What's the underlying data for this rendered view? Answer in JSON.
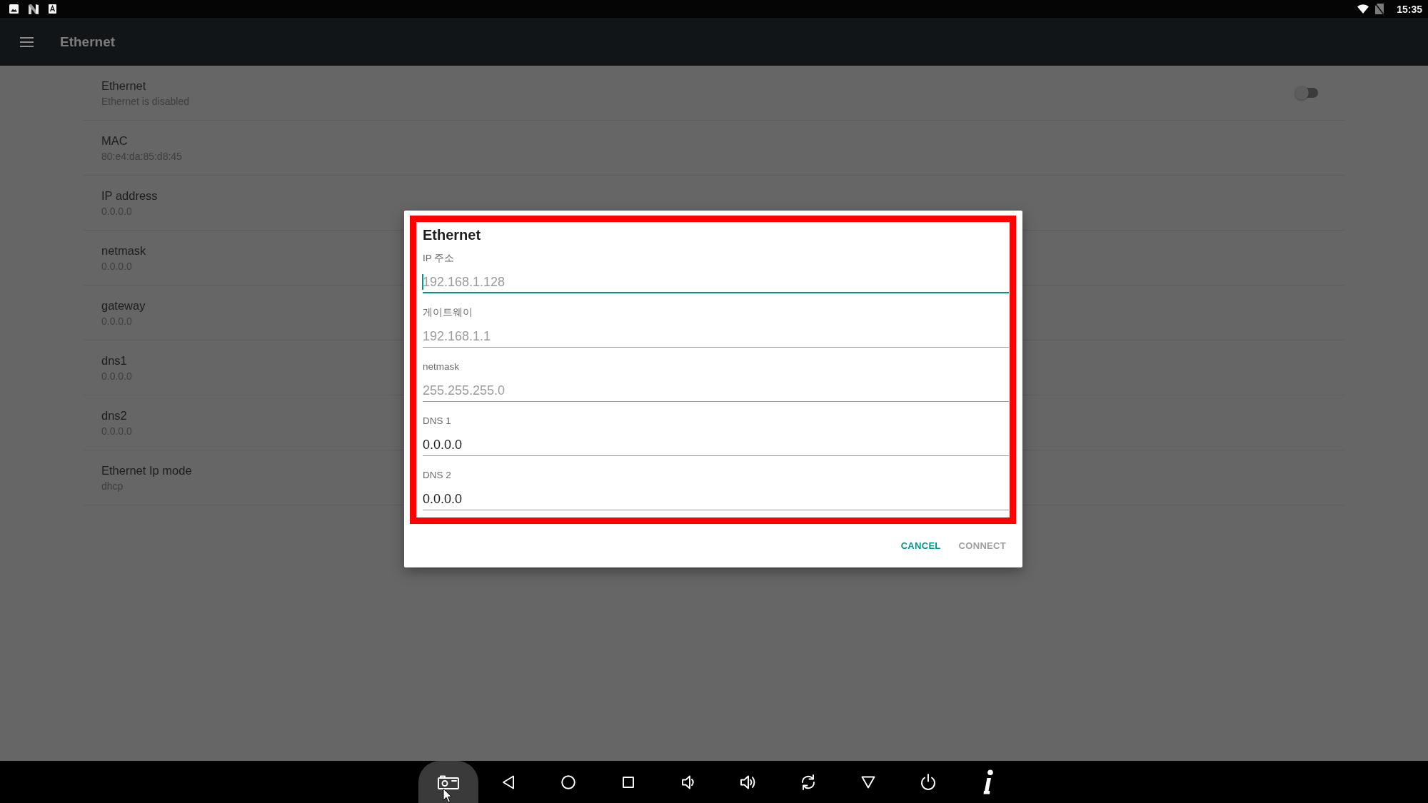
{
  "status_bar": {
    "time": "15:35"
  },
  "app_bar": {
    "title": "Ethernet"
  },
  "settings": [
    {
      "title": "Ethernet",
      "summary": "Ethernet is disabled",
      "switch": {
        "on": false
      }
    },
    {
      "title": "MAC",
      "summary": "80:e4:da:85:d8:45"
    },
    {
      "title": "IP address",
      "summary": "0.0.0.0"
    },
    {
      "title": "netmask",
      "summary": "0.0.0.0"
    },
    {
      "title": "gateway",
      "summary": "0.0.0.0"
    },
    {
      "title": "dns1",
      "summary": "0.0.0.0"
    },
    {
      "title": "dns2",
      "summary": "0.0.0.0"
    },
    {
      "title": "Ethernet Ip mode",
      "summary": "dhcp"
    }
  ],
  "dialog": {
    "highlighted": true,
    "title": "Ethernet",
    "fields": [
      {
        "label": "IP 주소",
        "placeholder": "192.168.1.128",
        "focused": true
      },
      {
        "label": "게이트웨이",
        "placeholder": "192.168.1.1",
        "focused": false
      },
      {
        "label": "netmask",
        "placeholder": "255.255.255.0",
        "focused": false
      },
      {
        "label": "DNS 1",
        "value": "0.0.0.0",
        "focused": false
      },
      {
        "label": "DNS 2",
        "value": "0.0.0.0",
        "focused": false
      }
    ],
    "buttons": [
      {
        "label": "CANCEL",
        "disabled": false
      },
      {
        "label": "CONNECT",
        "disabled": true
      }
    ]
  },
  "nav_bar": [
    {
      "kind": "screenshot",
      "hovered": true
    },
    {
      "kind": "back",
      "hovered": false
    },
    {
      "kind": "home",
      "hovered": false
    },
    {
      "kind": "recents",
      "hovered": false
    },
    {
      "kind": "volume_down",
      "hovered": false
    },
    {
      "kind": "volume_up",
      "hovered": false
    },
    {
      "kind": "rotate",
      "hovered": false
    },
    {
      "kind": "dropdown",
      "hovered": false
    },
    {
      "kind": "power",
      "hovered": false
    },
    {
      "kind": "info",
      "hovered": false
    }
  ]
}
